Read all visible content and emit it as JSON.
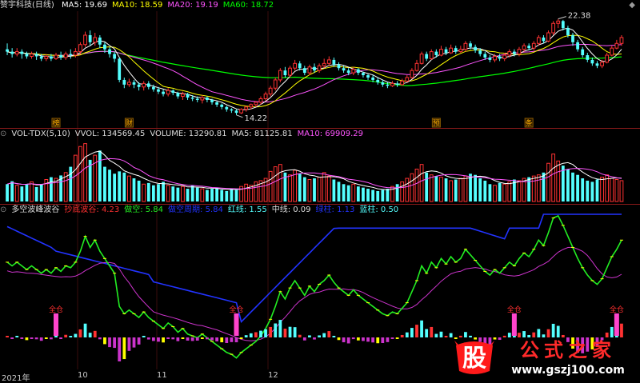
{
  "colors": {
    "up": "#ff3232",
    "down": "#54ffff",
    "ma5": "#ffffff",
    "ma10": "#ffff00",
    "ma20": "#ff55ff",
    "ma60": "#00ff00",
    "blue": "#2233ff",
    "green_line": "#22ee22",
    "magenta_line": "#cc33cc",
    "yellow": "#ffff00"
  },
  "main": {
    "title": "赞宇科技(日线)",
    "ma_items": [
      {
        "label": "MA5: 19.69",
        "color": "#ffffff"
      },
      {
        "label": "MA10: 18.59",
        "color": "#ffff00"
      },
      {
        "label": "MA20: 19.19",
        "color": "#ff55ff"
      },
      {
        "label": "MA60: 18.72",
        "color": "#00ff00"
      }
    ],
    "high_label": "22.38",
    "low_label": "14.22",
    "markers": [
      "榜",
      "财",
      "预",
      "条"
    ],
    "corner_glyph": "◆"
  },
  "vol": {
    "items": [
      {
        "label": "VOL-TDX(5,10)",
        "color": "#dddddd"
      },
      {
        "label": "VVOL: 134569.45",
        "color": "#dddddd"
      },
      {
        "label": "VOLUME: 13290.81",
        "color": "#dddddd"
      },
      {
        "label": "MA5: 81125.81",
        "color": "#dddddd"
      },
      {
        "label": "MA10: 69909.29",
        "color": "#ff55ff"
      }
    ]
  },
  "osc": {
    "items": [
      {
        "label": "多空波峰波谷",
        "color": "#dddddd"
      },
      {
        "label": "抄底波谷: 4.23",
        "color": "#ff3030"
      },
      {
        "label": "做空: 5.84",
        "color": "#22ee22"
      },
      {
        "label": "做空周期: 5.84",
        "color": "#2233ff"
      },
      {
        "label": "红线: 1.55",
        "color": "#54ffff"
      },
      {
        "label": "中线: 0.09",
        "color": "#dddddd"
      },
      {
        "label": "绿柱: 1.13",
        "color": "#2233ff"
      },
      {
        "label": "蓝柱: 0.50",
        "color": "#54ffff"
      }
    ],
    "signal_label": "全仓"
  },
  "axis": {
    "labels": [
      "2021年",
      "10",
      "11",
      "12"
    ]
  },
  "watermark": {
    "glyph": "股",
    "text": "公式之家",
    "url": "www.gszj100.com"
  },
  "chart_data": {
    "type": "candlestick",
    "high": 22.38,
    "low": 14.22,
    "ohlc": [
      [
        19.8,
        19.6,
        20.3,
        19.3
      ],
      [
        19.6,
        19.4,
        19.9,
        19.1
      ],
      [
        19.4,
        19.6,
        19.9,
        19.2
      ],
      [
        19.6,
        19.4,
        19.8,
        19.0
      ],
      [
        19.4,
        19.2,
        19.6,
        19.0
      ],
      [
        19.2,
        19.4,
        19.6,
        19.0
      ],
      [
        19.4,
        19.2,
        19.6,
        18.9
      ],
      [
        19.2,
        19.0,
        19.4,
        18.8
      ],
      [
        19.0,
        19.2,
        19.4,
        18.8
      ],
      [
        19.2,
        19.0,
        19.4,
        18.8
      ],
      [
        19.0,
        19.3,
        19.5,
        18.9
      ],
      [
        19.3,
        19.1,
        19.6,
        18.9
      ],
      [
        19.1,
        19.4,
        19.6,
        18.9
      ],
      [
        19.4,
        19.3,
        19.8,
        19.0
      ],
      [
        19.3,
        19.6,
        19.9,
        19.1
      ],
      [
        19.6,
        20.2,
        20.4,
        19.4
      ],
      [
        20.2,
        21.0,
        21.3,
        20.0
      ],
      [
        21.0,
        20.4,
        21.4,
        20.1
      ],
      [
        20.4,
        20.8,
        21.2,
        20.1
      ],
      [
        20.8,
        20.2,
        21.0,
        19.9
      ],
      [
        20.2,
        19.8,
        20.4,
        19.5
      ],
      [
        19.8,
        19.4,
        20.0,
        19.1
      ],
      [
        19.4,
        19.0,
        19.6,
        18.7
      ],
      [
        19.0,
        17.2,
        19.1,
        17.0
      ],
      [
        17.2,
        16.8,
        17.4,
        16.5
      ],
      [
        16.8,
        17.0,
        17.3,
        16.6
      ],
      [
        17.0,
        16.8,
        17.2,
        16.5
      ],
      [
        16.8,
        16.6,
        17.0,
        16.3
      ],
      [
        16.6,
        16.9,
        17.1,
        16.3
      ],
      [
        16.9,
        16.6,
        17.1,
        16.4
      ],
      [
        16.6,
        16.4,
        16.8,
        16.2
      ],
      [
        16.4,
        16.2,
        16.6,
        16.0
      ],
      [
        16.2,
        16.0,
        16.4,
        15.8
      ],
      [
        16.0,
        16.3,
        16.5,
        15.8
      ],
      [
        16.3,
        16.1,
        16.4,
        15.9
      ],
      [
        16.1,
        15.8,
        16.2,
        15.6
      ],
      [
        15.8,
        16.0,
        16.2,
        15.5
      ],
      [
        16.0,
        15.7,
        16.1,
        15.5
      ],
      [
        15.7,
        15.6,
        15.9,
        15.4
      ],
      [
        15.6,
        15.5,
        15.8,
        15.3
      ],
      [
        15.5,
        15.7,
        15.9,
        15.2
      ],
      [
        15.7,
        15.5,
        15.8,
        15.3
      ],
      [
        15.5,
        15.3,
        15.6,
        15.1
      ],
      [
        15.3,
        15.1,
        15.4,
        14.9
      ],
      [
        15.1,
        14.9,
        15.2,
        14.7
      ],
      [
        14.9,
        14.7,
        15.0,
        14.5
      ],
      [
        14.7,
        14.6,
        14.8,
        14.4
      ],
      [
        14.6,
        14.4,
        14.7,
        14.22
      ],
      [
        14.4,
        14.7,
        14.8,
        14.3
      ],
      [
        14.7,
        14.9,
        15.0,
        14.5
      ],
      [
        14.9,
        15.1,
        15.2,
        14.7
      ],
      [
        15.1,
        15.3,
        15.4,
        14.9
      ],
      [
        15.3,
        15.6,
        15.8,
        15.1
      ],
      [
        15.6,
        16.0,
        16.2,
        15.4
      ],
      [
        16.0,
        16.5,
        16.7,
        15.8
      ],
      [
        16.5,
        17.2,
        17.4,
        16.3
      ],
      [
        17.2,
        18.0,
        18.2,
        17.0
      ],
      [
        18.0,
        17.6,
        18.3,
        17.4
      ],
      [
        17.6,
        18.2,
        18.4,
        17.4
      ],
      [
        18.2,
        18.6,
        18.9,
        18.0
      ],
      [
        18.6,
        18.2,
        18.8,
        18.0
      ],
      [
        18.2,
        17.8,
        18.4,
        17.6
      ],
      [
        17.8,
        18.3,
        18.5,
        17.6
      ],
      [
        18.3,
        18.0,
        18.6,
        17.8
      ],
      [
        18.0,
        18.4,
        18.6,
        17.8
      ],
      [
        18.4,
        18.6,
        19.0,
        18.2
      ],
      [
        18.6,
        18.9,
        19.2,
        18.4
      ],
      [
        18.9,
        18.5,
        19.1,
        18.3
      ],
      [
        18.5,
        18.2,
        18.7,
        18.0
      ],
      [
        18.2,
        18.0,
        18.4,
        17.8
      ],
      [
        18.0,
        17.8,
        18.2,
        17.6
      ],
      [
        17.8,
        18.1,
        18.3,
        17.6
      ],
      [
        18.1,
        17.8,
        18.2,
        17.6
      ],
      [
        17.8,
        17.6,
        17.9,
        17.4
      ],
      [
        17.6,
        17.4,
        17.7,
        17.2
      ],
      [
        17.4,
        17.2,
        17.6,
        17.0
      ],
      [
        17.2,
        17.0,
        17.4,
        16.8
      ],
      [
        17.0,
        16.8,
        17.2,
        16.6
      ],
      [
        16.8,
        16.7,
        17.0,
        16.5
      ],
      [
        16.7,
        16.9,
        17.1,
        16.6
      ],
      [
        16.9,
        16.8,
        17.1,
        16.6
      ],
      [
        16.8,
        17.1,
        17.3,
        16.7
      ],
      [
        17.1,
        17.4,
        17.6,
        17.0
      ],
      [
        17.4,
        18.0,
        18.2,
        17.3
      ],
      [
        18.0,
        18.6,
        18.9,
        17.9
      ],
      [
        18.6,
        19.4,
        19.6,
        18.5
      ],
      [
        19.4,
        19.0,
        19.6,
        18.8
      ],
      [
        19.0,
        19.6,
        19.8,
        18.9
      ],
      [
        19.6,
        19.3,
        19.8,
        19.1
      ],
      [
        19.3,
        19.8,
        20.1,
        19.2
      ],
      [
        19.8,
        19.5,
        20.0,
        19.3
      ],
      [
        19.5,
        19.9,
        20.2,
        19.4
      ],
      [
        19.9,
        19.6,
        20.1,
        19.4
      ],
      [
        19.6,
        19.8,
        20.1,
        19.5
      ],
      [
        19.8,
        20.3,
        20.5,
        19.6
      ],
      [
        20.3,
        20.0,
        20.5,
        19.8
      ],
      [
        20.0,
        19.7,
        20.2,
        19.5
      ],
      [
        19.7,
        19.4,
        19.9,
        19.2
      ],
      [
        19.4,
        19.1,
        19.6,
        18.9
      ],
      [
        19.1,
        18.9,
        19.3,
        18.7
      ],
      [
        18.9,
        19.2,
        19.4,
        18.7
      ],
      [
        19.2,
        19.0,
        19.4,
        18.8
      ],
      [
        19.0,
        19.3,
        19.5,
        18.8
      ],
      [
        19.3,
        19.6,
        19.8,
        19.1
      ],
      [
        19.6,
        19.4,
        19.8,
        19.2
      ],
      [
        19.4,
        19.8,
        20.0,
        19.2
      ],
      [
        19.8,
        20.1,
        20.3,
        19.6
      ],
      [
        20.1,
        19.9,
        20.3,
        19.7
      ],
      [
        19.9,
        20.3,
        20.5,
        19.7
      ],
      [
        20.3,
        20.8,
        21.0,
        20.1
      ],
      [
        20.8,
        20.5,
        21.0,
        20.3
      ],
      [
        20.5,
        21.2,
        21.4,
        20.4
      ],
      [
        21.2,
        22.0,
        22.2,
        21.0
      ],
      [
        22.0,
        22.2,
        22.38,
        21.6
      ],
      [
        22.2,
        21.6,
        22.3,
        21.4
      ],
      [
        21.6,
        21.0,
        21.8,
        20.8
      ],
      [
        21.0,
        20.4,
        21.2,
        20.1
      ],
      [
        20.4,
        19.8,
        20.6,
        19.6
      ],
      [
        19.8,
        19.3,
        20.0,
        19.1
      ],
      [
        19.3,
        18.9,
        19.5,
        18.7
      ],
      [
        18.9,
        18.6,
        19.1,
        18.4
      ],
      [
        18.6,
        18.4,
        18.8,
        18.2
      ],
      [
        18.4,
        18.7,
        18.9,
        18.2
      ],
      [
        18.7,
        19.3,
        19.5,
        18.6
      ],
      [
        19.3,
        19.9,
        20.1,
        19.2
      ],
      [
        19.9,
        20.3,
        20.6,
        19.8
      ],
      [
        20.3,
        20.8,
        21.0,
        20.1
      ]
    ],
    "volume": [
      30,
      35,
      28,
      26,
      30,
      34,
      25,
      30,
      38,
      42,
      40,
      45,
      50,
      60,
      80,
      95,
      100,
      72,
      80,
      88,
      60,
      55,
      48,
      52,
      50,
      44,
      40,
      36,
      30,
      32,
      28,
      30,
      34,
      28,
      26,
      24,
      26,
      22,
      28,
      24,
      22,
      20,
      22,
      24,
      20,
      18,
      22,
      20,
      26,
      30,
      28,
      34,
      36,
      40,
      52,
      60,
      64,
      50,
      46,
      54,
      48,
      42,
      38,
      40,
      42,
      50,
      44,
      38,
      34,
      30,
      28,
      30,
      26,
      24,
      22,
      20,
      18,
      20,
      22,
      26,
      30,
      34,
      40,
      48,
      56,
      64,
      50,
      46,
      44,
      42,
      40,
      36,
      38,
      40,
      44,
      48,
      46,
      40,
      36,
      30,
      28,
      32,
      30,
      34,
      38,
      36,
      40,
      42,
      44,
      46,
      50,
      66,
      82,
      70,
      62,
      56,
      50,
      46,
      40,
      36,
      34,
      38,
      42,
      46,
      40,
      38,
      36
    ]
  }
}
